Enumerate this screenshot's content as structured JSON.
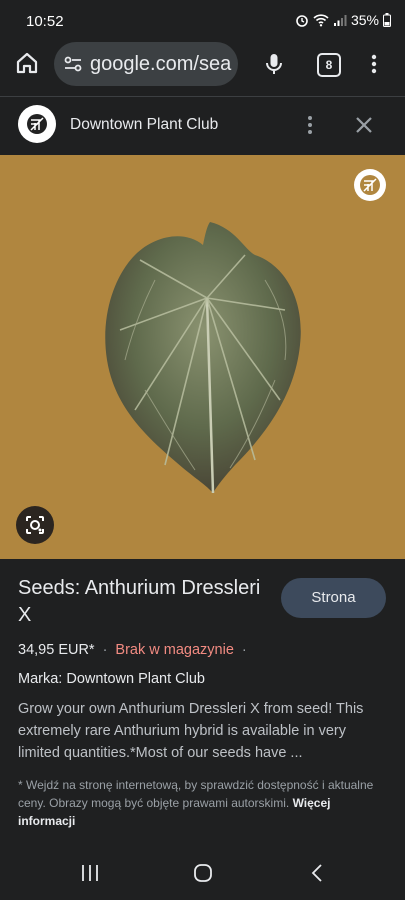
{
  "status": {
    "time": "10:52",
    "battery": "35%"
  },
  "toolbar": {
    "url": "google.com/sea",
    "tab_count": "8"
  },
  "panel": {
    "title": "Downtown Plant Club"
  },
  "product": {
    "title": "Seeds: Anthurium Dressleri X",
    "site_button": "Strona",
    "price": "34,95 EUR*",
    "availability": "Brak w magazynie",
    "brand": "Marka: Downtown Plant Club",
    "description": "Grow your own Anthurium Dressleri X from seed! This extremely rare Anthurium hybrid is available in very limited quantities.*Most of our seeds have ...",
    "disclaimer": "* Wejdź na stronę internetową, by sprawdzić dostępność i aktualne ceny. Obrazy mogą być objęte prawami autorskimi.",
    "more_info": "Więcej informacji"
  },
  "colors": {
    "image_background": "#b0863f",
    "availability": "#f28b82",
    "button": "#3d4a5c"
  },
  "icons": [
    "alarm-icon",
    "wifi-icon",
    "signal-icon",
    "battery-icon",
    "home-icon",
    "site-settings-icon",
    "mic-icon",
    "tabs-icon",
    "more-vert-icon",
    "close-icon",
    "lens-icon",
    "recent-apps-icon",
    "home-nav-icon",
    "back-icon"
  ]
}
